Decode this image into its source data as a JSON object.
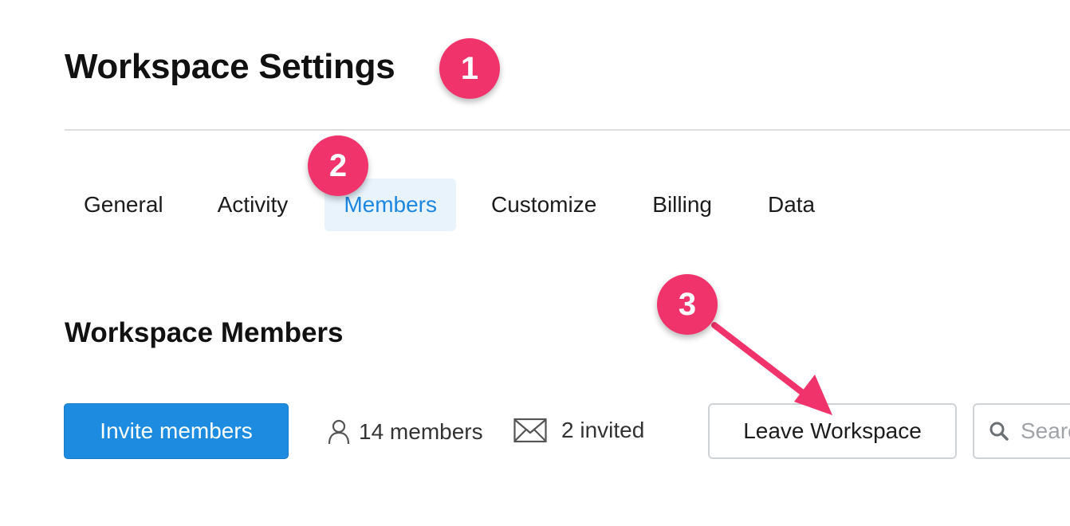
{
  "header": {
    "title": "Workspace Settings"
  },
  "tabs": [
    {
      "label": "General",
      "active": false
    },
    {
      "label": "Activity",
      "active": false
    },
    {
      "label": "Members",
      "active": true
    },
    {
      "label": "Customize",
      "active": false
    },
    {
      "label": "Billing",
      "active": false
    },
    {
      "label": "Data",
      "active": false
    }
  ],
  "members_section": {
    "title": "Workspace Members",
    "invite_button_label": "Invite members",
    "member_count_text": "14 members",
    "invited_count_text": "2 invited",
    "leave_button_label": "Leave Workspace",
    "search_placeholder": "Search"
  },
  "annotations": {
    "badges": [
      "1",
      "2",
      "3"
    ],
    "badge_color": "#f1336b"
  },
  "icons": {
    "member_icon": "person-icon",
    "invited_icon": "envelope-icon",
    "search_icon": "search-icon"
  },
  "colors": {
    "accent": "#1d8ce0",
    "active_tab_text": "#1d87e0",
    "active_tab_bg": "#e8f3fc"
  }
}
